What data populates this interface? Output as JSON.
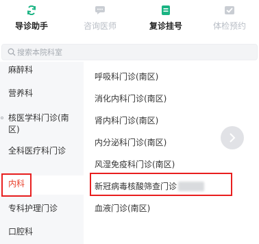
{
  "tabs": [
    {
      "label": "导诊助手",
      "icon": "swap-arrows-icon",
      "state": "active"
    },
    {
      "label": "咨询医师",
      "icon": "chat-icon",
      "state": "dim"
    },
    {
      "label": "复诊挂号",
      "icon": "document-icon",
      "state": "active"
    },
    {
      "label": "体检预约",
      "icon": "checkup-icon",
      "state": "dim"
    }
  ],
  "search": {
    "placeholder": "搜索本院科室"
  },
  "departments": [
    {
      "label": "麻醉科"
    },
    {
      "label": "营养科"
    },
    {
      "label": "核医学科门诊(南区)"
    },
    {
      "label": "全科医疗科门诊"
    },
    {
      "label": "内科",
      "selected": true
    },
    {
      "label": "专科护理门诊"
    },
    {
      "label": "口腔科"
    }
  ],
  "clinics": [
    {
      "label": "呼吸科门诊(南区)"
    },
    {
      "label": "消化内科门诊(南区)"
    },
    {
      "label": "肾内科门诊(南区)"
    },
    {
      "label": "内分泌科门诊(南区)"
    },
    {
      "label": "风湿免疫科门诊(南区)"
    },
    {
      "label": "新冠病毒核酸筛查门诊",
      "redacted_suffix": true
    },
    {
      "label": "血液门诊(南区)"
    }
  ],
  "colors": {
    "accent_green": "#19b382",
    "selected_text": "#e8402b",
    "highlight_box": "#e81e1e",
    "left_panel_bg": "#f6f7f9"
  }
}
